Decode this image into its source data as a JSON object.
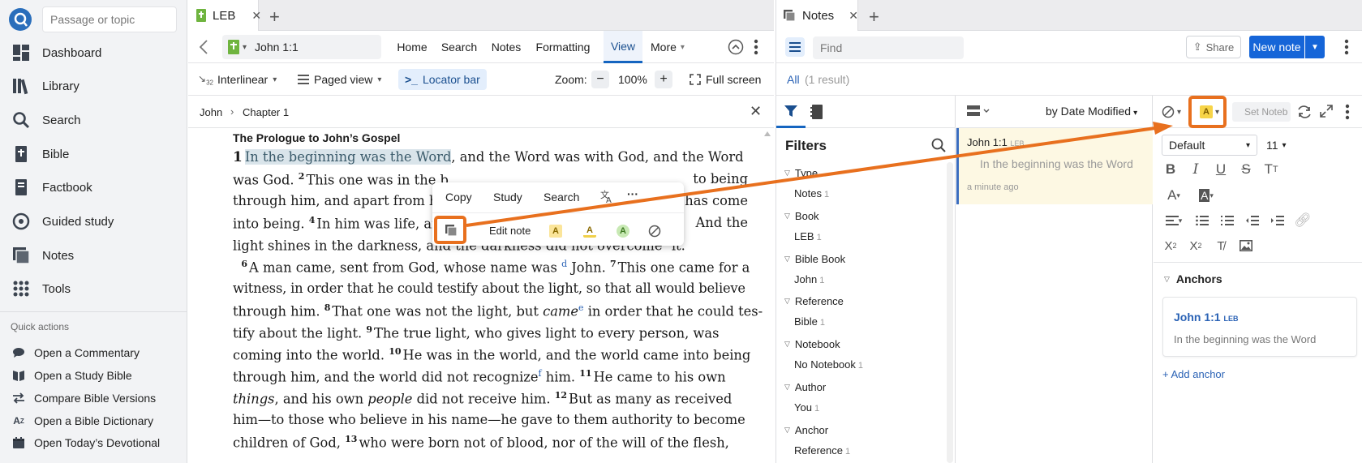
{
  "sidebar": {
    "search_placeholder": "Passage or topic",
    "nav": [
      {
        "label": "Dashboard",
        "icon": "dashboard-icon"
      },
      {
        "label": "Library",
        "icon": "library-icon"
      },
      {
        "label": "Search",
        "icon": "search-icon"
      },
      {
        "label": "Bible",
        "icon": "bible-icon"
      },
      {
        "label": "Factbook",
        "icon": "factbook-icon"
      },
      {
        "label": "Guided study",
        "icon": "guided-study-icon"
      },
      {
        "label": "Notes",
        "icon": "notes-icon"
      },
      {
        "label": "Tools",
        "icon": "tools-icon"
      }
    ],
    "quick_actions_title": "Quick actions",
    "quick_actions": [
      {
        "label": "Open a Commentary",
        "icon": "commentary-icon"
      },
      {
        "label": "Open a Study Bible",
        "icon": "study-bible-icon"
      },
      {
        "label": "Compare Bible Versions",
        "icon": "compare-icon"
      },
      {
        "label": "Open a Bible Dictionary",
        "icon": "dictionary-icon"
      },
      {
        "label": "Open Today’s Devotional",
        "icon": "calendar-icon"
      }
    ]
  },
  "bible": {
    "tab_label": "LEB",
    "tab_close": "✕",
    "tab_add": "+",
    "reference": "John 1:1",
    "menu": [
      "Home",
      "Search",
      "Notes",
      "Formatting",
      "View",
      "More"
    ],
    "active_menu": "View",
    "view_bar": {
      "interlinear": "Interlinear",
      "paged_view": "Paged view",
      "locator_bar": "Locator bar",
      "zoom_label": "Zoom:",
      "zoom_minus": "−",
      "zoom_value": "100%",
      "zoom_plus": "+",
      "full_screen": "Full screen"
    },
    "breadcrumb": {
      "book": "John",
      "sep": "›",
      "chapter": "Chapter 1",
      "close": "✕"
    },
    "section_title": "The Prologue to John’s Gospel",
    "text": {
      "v1_num": "1",
      "v1_hl": "In the beginning was the Word",
      "v1_rest": ", and the Word was with God, and the Word",
      "l2a": "was God.",
      "v2_num": "2",
      "l2b": "This one was in the b",
      "l2c": "to being",
      "l3a": "through him, and apart from hi",
      "l3b": "has come",
      "l4a": "into being.",
      "v4_num": "4",
      "l4b": "In him was life, an",
      "l4c": "And the",
      "l5a": "light shines in the darkness, and the darkness did not overcome",
      "fn_c": "c",
      "l5b": " it.",
      "v6_num": "6",
      "l6a": "A man came, sent from God,",
      "l6b": "whose name was",
      "fn_d": "d",
      "l6c": " John.",
      "v7_num": "7",
      "l6d": "This one came for a",
      "l7": "witness, in order that he could testify about the light, so that all would believe",
      "l8a": "through him.",
      "v8_num": "8",
      "l8b": "That one was not the light, but",
      "l8c": "came",
      "fn_e": "e",
      "l8d": " in order that he could tes-",
      "l9a": "tify about the light.",
      "v9_num": "9",
      "l9b": "The true light, who gives light to every person, was",
      "l10a": "coming into the world.",
      "v10_num": "10",
      "l10b": "He was in the world, and the world came into being",
      "l11a": "through him, and the world did not recognize",
      "fn_f": "f",
      "l11b": " him.",
      "v11_num": "11",
      "l11c": "He came to his own",
      "l12a": "things",
      "l12b": ", and his own",
      "l12c": "people",
      "l12d": " did not receive him.",
      "v12_num": "12",
      "l12e": "But as many as received",
      "l13": "him—to those who believe in his name—he gave to them authority to become",
      "l14a": "children of God,",
      "v13_num": "13",
      "l14b": "who were born not of blood, nor of the will of the flesh,"
    },
    "popup": {
      "copy": "Copy",
      "study": "Study",
      "search": "Search",
      "more": "···",
      "edit_note": "Edit note",
      "hl_letter": "A"
    }
  },
  "notes": {
    "tab_label": "Notes",
    "tab_close": "✕",
    "tab_add": "+",
    "find_placeholder": "Find",
    "share": "Share",
    "new_note": "New note",
    "all_label": "All",
    "result_count": "(1 result)",
    "filters_title": "Filters",
    "filters": [
      {
        "section": "Type",
        "value": "Notes",
        "count": "1"
      },
      {
        "section": "Book",
        "value": "LEB",
        "count": "1"
      },
      {
        "section": "Bible Book",
        "value": "John",
        "count": "1"
      },
      {
        "section": "Reference",
        "value": "Bible",
        "count": "1"
      },
      {
        "section": "Notebook",
        "value": "No Notebook",
        "count": "1"
      },
      {
        "section": "Author",
        "value": "You",
        "count": "1"
      },
      {
        "section": "Anchor",
        "value": "Reference",
        "count": "1"
      }
    ],
    "sort_label": "by Date Modified",
    "note": {
      "ref": "John 1:1",
      "version": "LEB",
      "excerpt": "In the beginning was the Word",
      "time": "a minute ago"
    },
    "editor": {
      "notebook_placeholder": "Set Noteb",
      "font": "Default",
      "size": "11",
      "hl_letter": "A",
      "anchors_title": "Anchors",
      "anchor_ref": "John 1:1",
      "anchor_version": "LEB",
      "anchor_text": "In the beginning was the Word",
      "add_anchor": "+ Add anchor"
    }
  },
  "colors": {
    "accent": "#1565d8",
    "annotation": "#e8701e",
    "highlight_yellow": "#f7d448",
    "highlight_green": "#8bcf6a"
  }
}
